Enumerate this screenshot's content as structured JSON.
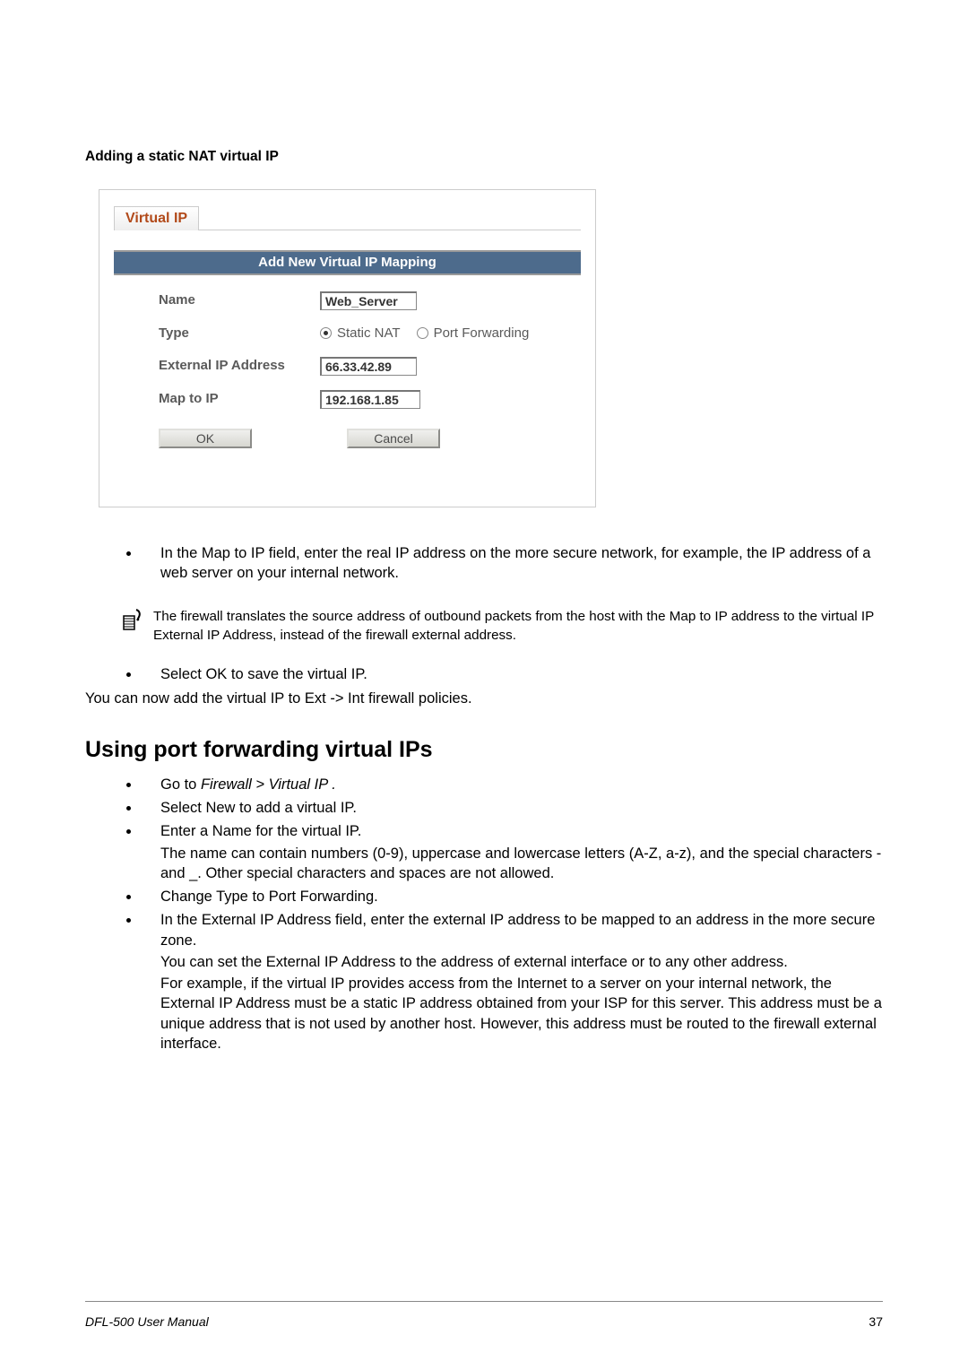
{
  "caption": "Adding a static NAT virtual IP",
  "tab": "Virtual IP",
  "panel": {
    "header": "Add New Virtual IP Mapping",
    "labels": {
      "name": "Name",
      "type": "Type",
      "ext_ip": "External IP Address",
      "map_ip": "Map to IP"
    },
    "values": {
      "name": "Web_Server",
      "ext_ip": "66.33.42.89",
      "map_ip": "192.168.1.85"
    },
    "type_options": {
      "static_nat": "Static NAT",
      "port_fwd": "Port Forwarding"
    },
    "buttons": {
      "ok": "OK",
      "cancel": "Cancel"
    }
  },
  "body": {
    "bullet1": "In the Map to IP field, enter the real IP address on the more secure network, for example, the IP address of a web server on your internal network.",
    "note": "The firewall translates the source address of outbound packets from the host with the Map to IP address to the virtual IP External IP Address, instead of the firewall external address.",
    "bullet2": "Select OK to save the virtual IP.",
    "after": "You can now add the virtual IP to Ext -> Int firewall policies.",
    "heading": "Using port forwarding virtual IPs",
    "b3_prefix": "Go to ",
    "b3_italic": "Firewall > Virtual IP .",
    "b4": "Select New to add a virtual IP.",
    "b5": "Enter a Name for the virtual IP.",
    "b5_sub": "The name can contain numbers (0-9), uppercase and lowercase letters (A-Z, a-z), and the special characters - and _. Other special characters and spaces are not allowed.",
    "b6": "Change Type to Port Forwarding.",
    "b7": "In the External IP Address field, enter the external IP address to be mapped to an address in the more secure zone.",
    "b7_sub1": "You can set the External IP Address to the address of external interface or to any other address.",
    "b7_sub2": "For example, if the virtual IP provides access from the Internet to a server on your internal network, the External IP Address must be a static IP address obtained from your ISP for this server. This address must be a unique address that is not used by another host. However, this address must be routed to the firewall external interface."
  },
  "footer": {
    "manual": "DFL-500 User Manual",
    "page": "37"
  }
}
